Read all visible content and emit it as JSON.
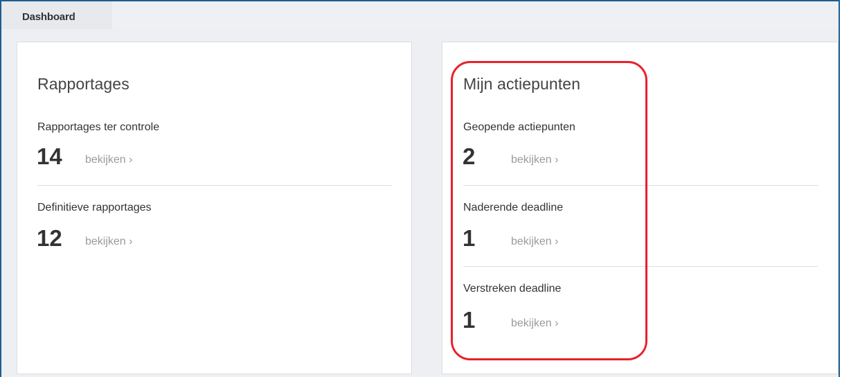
{
  "header": {
    "title": "Dashboard"
  },
  "reports_card": {
    "title": "Rapportages",
    "items": [
      {
        "label": "Rapportages ter controle",
        "count": "14",
        "link": "bekijken ›"
      },
      {
        "label": "Definitieve rapportages",
        "count": "12",
        "link": "bekijken ›"
      }
    ]
  },
  "actions_card": {
    "title": "Mijn actiepunten",
    "items": [
      {
        "label": "Geopende actiepunten",
        "count": "2",
        "link": "bekijken ›"
      },
      {
        "label": "Naderende deadline",
        "count": "1",
        "link": "bekijken ›"
      },
      {
        "label": "Verstreken deadline",
        "count": "1",
        "link": "bekijken ›"
      }
    ]
  },
  "colors": {
    "frame_border": "#1d5c91",
    "highlight": "#e8202a",
    "link": "#9a9a9a"
  }
}
